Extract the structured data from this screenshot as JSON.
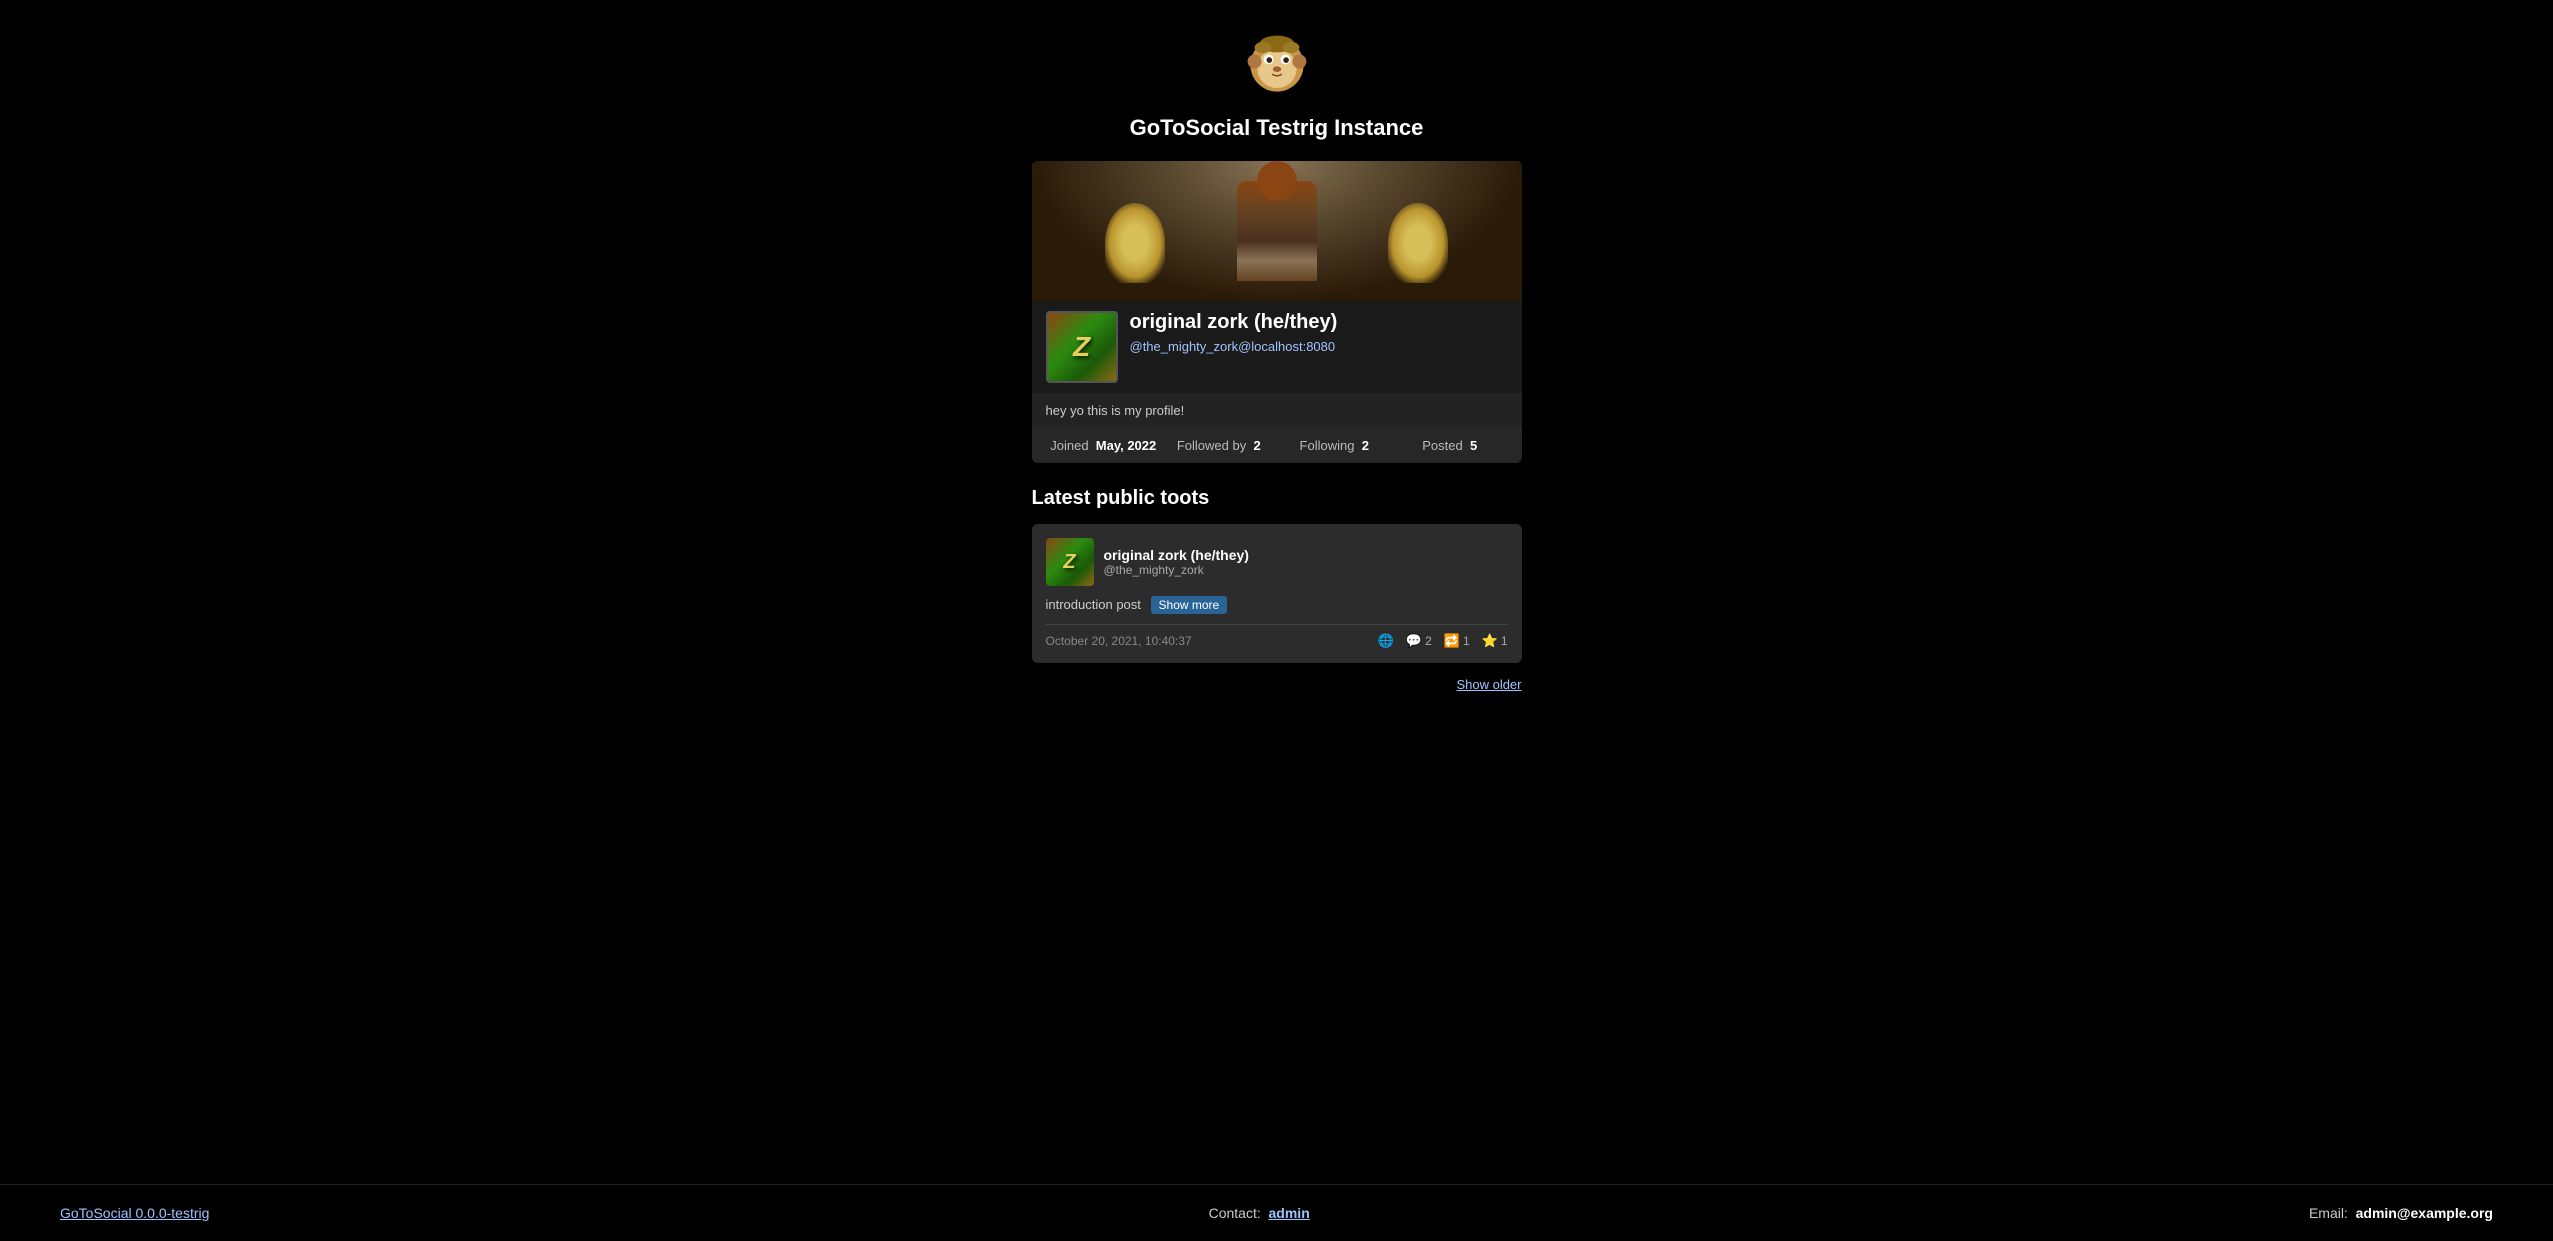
{
  "site": {
    "title": "GoToSocial Testrig Instance",
    "logo_alt": "GoToSocial sloth logo"
  },
  "profile": {
    "display_name": "original zork (he/they)",
    "username": "@the_mighty_zork@localhost:8080",
    "bio": "hey yo this is my profile!",
    "stats": {
      "joined_label": "Joined",
      "joined_date": "May, 2022",
      "followed_by_label": "Followed by",
      "followed_by_count": "2",
      "following_label": "Following",
      "following_count": "2",
      "posted_label": "Posted",
      "posted_count": "5"
    }
  },
  "latest_toots": {
    "section_title": "Latest public toots",
    "posts": [
      {
        "author_name": "original zork (he/they)",
        "author_handle": "@the_mighty_zork",
        "content": "introduction post",
        "show_more_label": "Show more",
        "timestamp": "October 20, 2021, 10:40:37",
        "reply_count": "2",
        "boost_count": "1",
        "favorite_count": "1"
      }
    ],
    "show_older_label": "Show older"
  },
  "footer": {
    "version_link": "GoToSocial 0.0.0-testrig",
    "contact_label": "Contact:",
    "contact_value": "admin",
    "email_label": "Email:",
    "email_value": "admin@example.org"
  }
}
